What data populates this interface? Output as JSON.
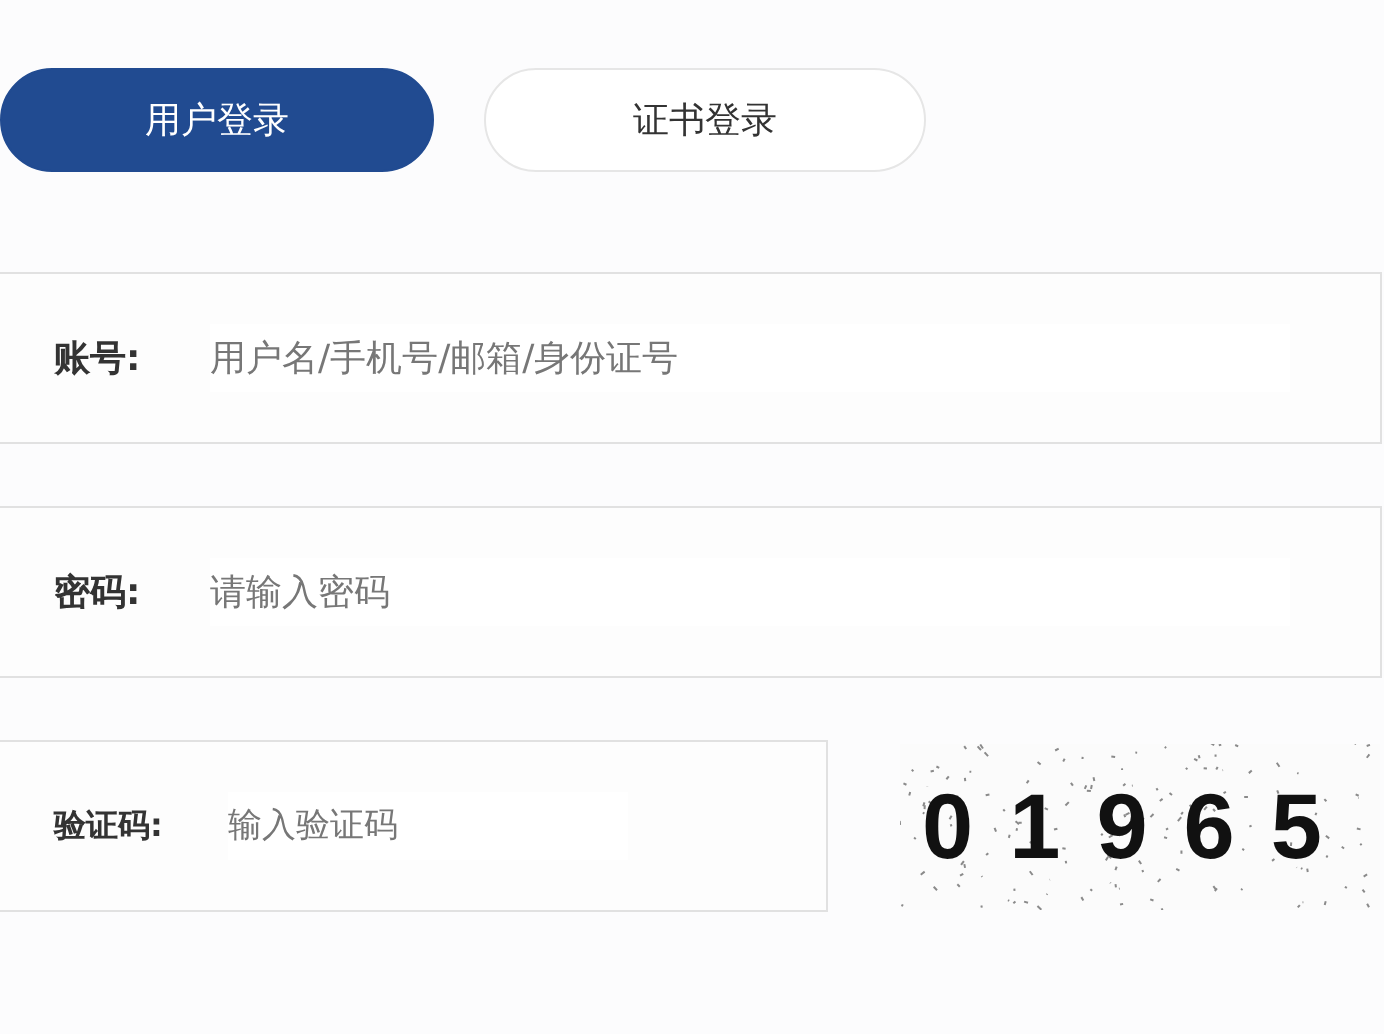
{
  "tabs": [
    {
      "label": "用户登录",
      "selected": true
    },
    {
      "label": "证书登录",
      "selected": false
    }
  ],
  "fields": [
    {
      "label": "账号:",
      "placeholder": "用户名/手机号/邮箱/身份证号"
    },
    {
      "label": "密码:",
      "placeholder": "请输入密码"
    }
  ],
  "captcha": {
    "label": "验证码:",
    "placeholder": "输入验证码",
    "code": "01965"
  }
}
